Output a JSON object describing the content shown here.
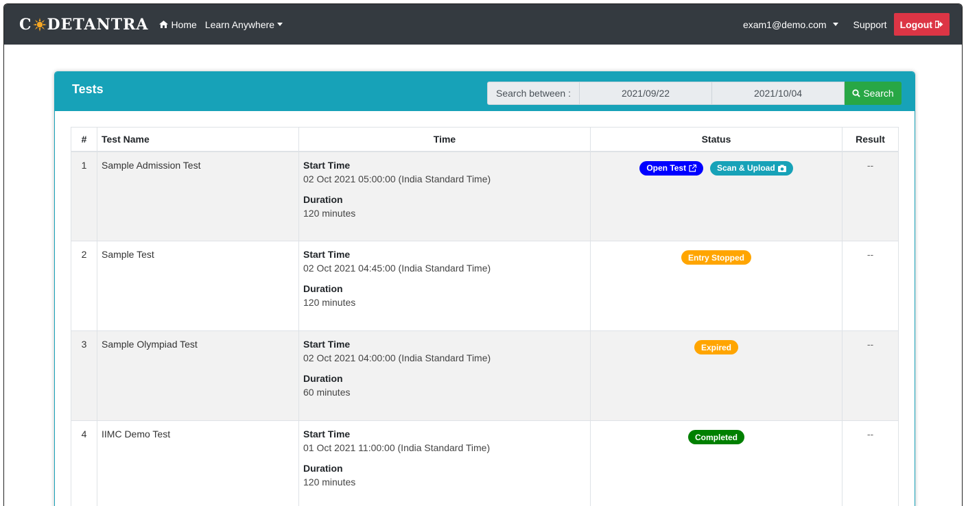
{
  "navbar": {
    "brand_c": "C",
    "brand_rest": "DETANTRA",
    "home_label": "Home",
    "learn_label": "Learn Anywhere",
    "user_email": "exam1@demo.com",
    "support_label": "Support",
    "logout_label": "Logout"
  },
  "card": {
    "title": "Tests",
    "search_label": "Search between :",
    "date_from": "2021/09/22",
    "date_to": "2021/10/04",
    "search_button": "Search"
  },
  "table": {
    "headers": [
      "#",
      "Test Name",
      "Time",
      "Status",
      "Result"
    ],
    "start_label": "Start Time",
    "duration_label": "Duration",
    "rows": [
      {
        "num": "1",
        "name": "Sample Admission Test",
        "start": "02 Oct 2021 05:00:00 (India Standard Time)",
        "duration": "120 minutes",
        "status": [
          "Open Test",
          "Scan & Upload"
        ],
        "result": "--"
      },
      {
        "num": "2",
        "name": "Sample Test",
        "start": "02 Oct 2021 04:45:00 (India Standard Time)",
        "duration": "120 minutes",
        "status": [
          "Entry Stopped"
        ],
        "result": "--"
      },
      {
        "num": "3",
        "name": "Sample Olympiad Test",
        "start": "02 Oct 2021 04:00:00 (India Standard Time)",
        "duration": "60 minutes",
        "status": [
          "Expired"
        ],
        "result": "--"
      },
      {
        "num": "4",
        "name": "IIMC Demo Test",
        "start": "01 Oct 2021 11:00:00 (India Standard Time)",
        "duration": "120 minutes",
        "status": [
          "Completed"
        ],
        "result": "--"
      }
    ]
  },
  "colors": {
    "navbar": "#343a40",
    "header": "#17a2b8",
    "logout": "#dc3545",
    "search": "#28a745",
    "open_test": "#0000ff",
    "scan_upload": "#17a2b8",
    "entry_stopped": "#ffa500",
    "expired": "#ffa500",
    "completed": "#008000"
  },
  "icons": {
    "home": "home-icon",
    "logout": "sign-out-icon",
    "search": "search-icon",
    "open_test": "external-link-icon",
    "scan_upload": "camera-icon"
  }
}
